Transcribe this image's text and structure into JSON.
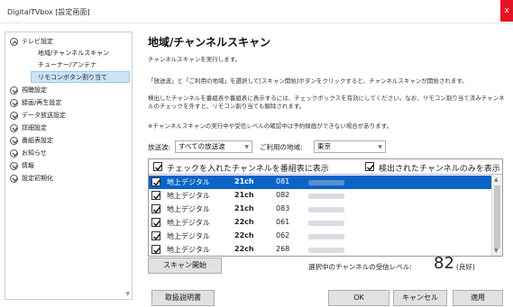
{
  "window": {
    "title": "DigitalTVbox [設定画面]",
    "close_glyph": "x"
  },
  "sidebar": {
    "items": [
      {
        "label": "テレビ設定",
        "expanded": true
      },
      {
        "label": "地域/チャンネルスキャン",
        "child": true
      },
      {
        "label": "チューナー/アンテナ",
        "child": true
      },
      {
        "label": "リモコンボタン割り当て",
        "child": true,
        "selected": true
      },
      {
        "label": "視聴設定",
        "expanded": false
      },
      {
        "label": "録画/再生設定",
        "expanded": false
      },
      {
        "label": "データ放送設定",
        "expanded": false
      },
      {
        "label": "詳細設定",
        "expanded": false
      },
      {
        "label": "番組表設定",
        "expanded": false
      },
      {
        "label": "お知らせ",
        "expanded": false
      },
      {
        "label": "情報",
        "expanded": false
      },
      {
        "label": "設定初期化",
        "expanded": false
      }
    ]
  },
  "main": {
    "heading": "地域/チャンネルスキャン",
    "desc1": "チャンネルスキャンを実行します。",
    "desc2": "「放送波」と「ご利用の地域」を選択して[スキャン開始]ボタンをクリックすると、チャンネルスキャンが開始されます。",
    "desc3_line1": "検出したチャンネルを番組表や番組表に表示するには、チェックボックスを有効にしてください。なお、リモコン割り当て済みチャンネ",
    "desc3_line2": "ルのチェックを外すと、リモコン割り当ても解除されます。",
    "desc4": "※チャンネルスキャンの実行中や受信レベルの確認中は予約録画ができない場合があります。"
  },
  "filters": {
    "broadcast_label": "放送波:",
    "broadcast_value": "すべての放送波",
    "region_label": "ご利用の地域:",
    "region_value": "東京"
  },
  "channel_list": {
    "header_show": "チェックを入れたチャンネルを番組表に表示",
    "header_detected": "検出されたチャンネルのみを表示",
    "rows": [
      {
        "type": "地上デジタル",
        "ch": "21ch",
        "num": "081",
        "checked": true,
        "selected": true
      },
      {
        "type": "地上デジタル",
        "ch": "21ch",
        "num": "082",
        "checked": true
      },
      {
        "type": "地上デジタル",
        "ch": "21ch",
        "num": "083",
        "checked": true
      },
      {
        "type": "地上デジタル",
        "ch": "22ch",
        "num": "061",
        "checked": true
      },
      {
        "type": "地上デジタル",
        "ch": "22ch",
        "num": "062",
        "checked": true
      },
      {
        "type": "地上デジタル",
        "ch": "22ch",
        "num": "268",
        "checked": true
      }
    ]
  },
  "scan": {
    "button_label": "スキャン開始",
    "signal_label": "選択中のチャンネルの受信レベル:",
    "signal_value": "82",
    "signal_quality": "(良好)"
  },
  "footer": {
    "manual_label": "取扱説明書",
    "ok_label": "OK",
    "cancel_label": "キャンセル",
    "apply_label": "適用"
  },
  "colors": {
    "accent": "#0a64c8",
    "close": "#e81123",
    "selection_bg": "#cce4f7"
  }
}
